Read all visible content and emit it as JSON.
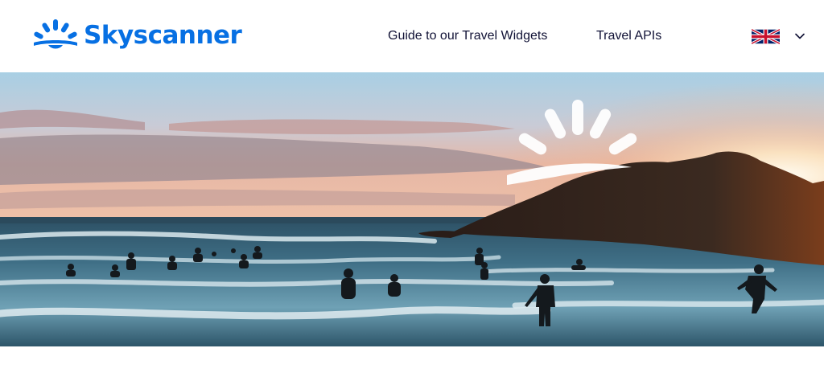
{
  "brand": {
    "name": "Skyscanner",
    "color": "#0770e3",
    "logo_icon": "sunrise-logo-icon"
  },
  "nav": {
    "guide_label": "Guide to our Travel Widgets",
    "apis_label": "Travel APIs"
  },
  "language": {
    "flag_icon": "uk-flag-icon",
    "dropdown_icon": "chevron-down-icon"
  },
  "hero": {
    "image": "beach-sunset-swimmers",
    "overlay_icon": "sunrise-logo-icon"
  },
  "colors": {
    "nav_text": "#111236",
    "sky_top": "#a9cfe3",
    "sunset_glow": "#f6b58a",
    "sea": "#3f6f86"
  }
}
